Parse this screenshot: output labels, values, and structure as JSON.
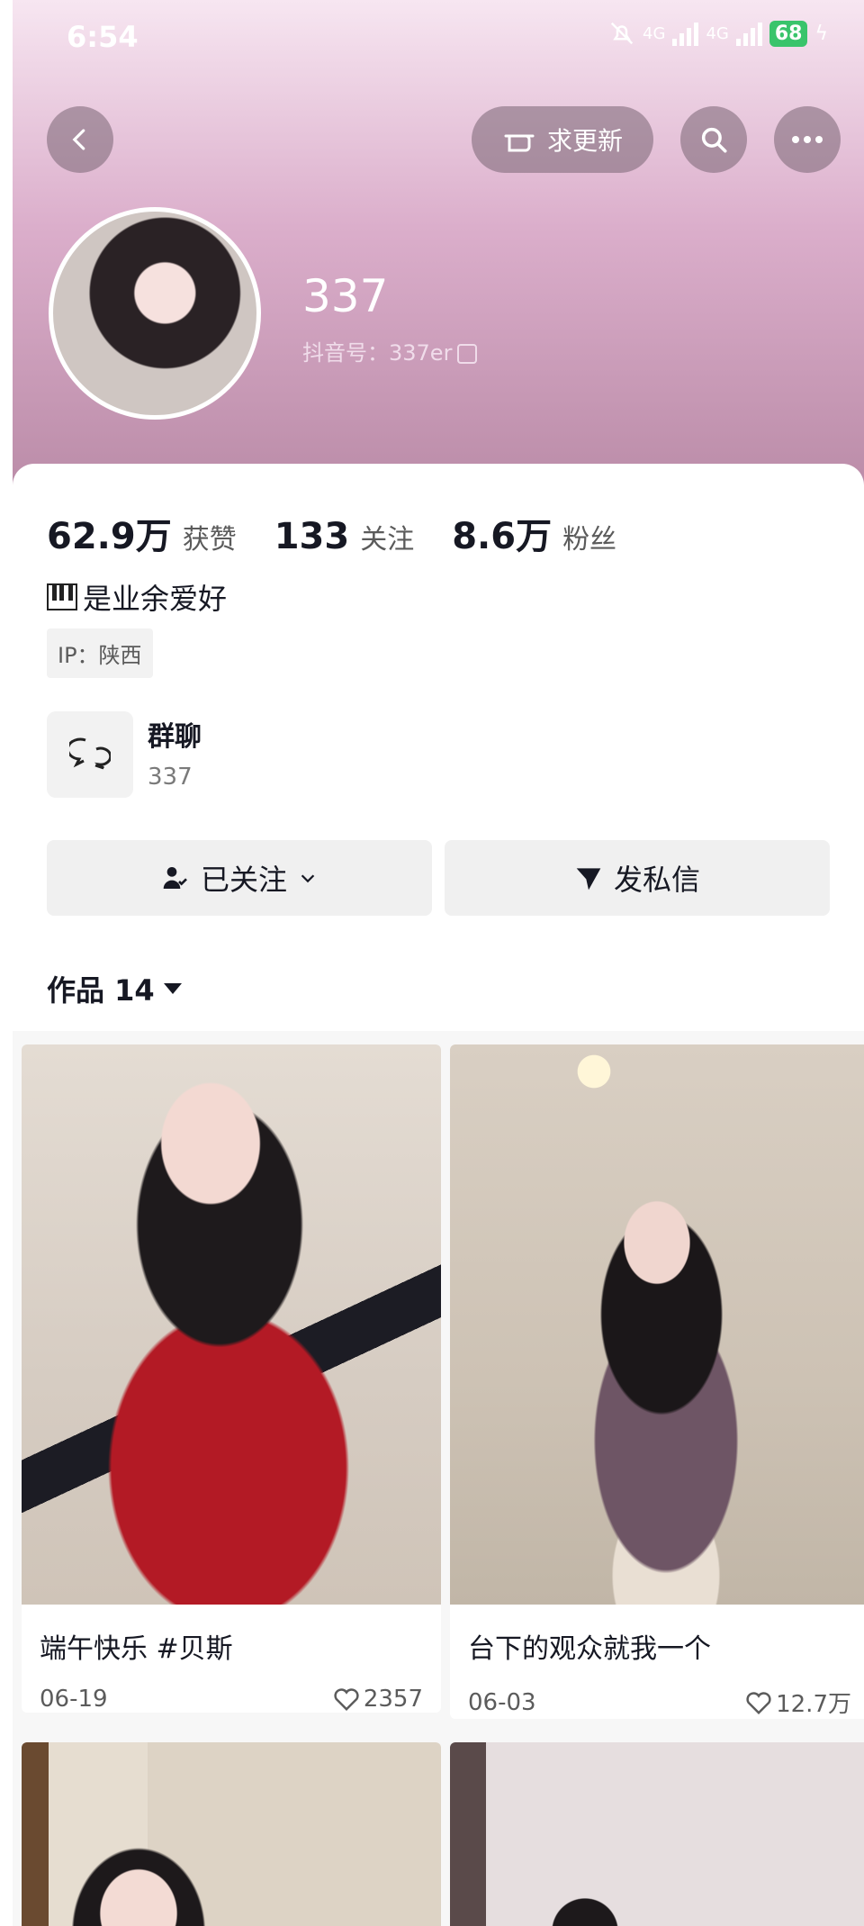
{
  "status_bar": {
    "time": "6:54",
    "network_1": "4G",
    "network_2": "4G",
    "battery": "68"
  },
  "header": {
    "ask_update_label": "求更新"
  },
  "profile": {
    "nickname": "337",
    "douyin_id": "抖音号：337er",
    "stats": [
      {
        "value": "62.9万",
        "label": "获赞"
      },
      {
        "value": "133",
        "label": "关注"
      },
      {
        "value": "8.6万",
        "label": "粉丝"
      }
    ],
    "bio": "是业余爱好",
    "ip": "IP：陕西"
  },
  "group_chat": {
    "title": "群聊",
    "subtitle": "337"
  },
  "actions": {
    "follow_label": "已关注",
    "message_label": "发私信"
  },
  "works": {
    "tab_label": "作品 14"
  },
  "posts": [
    {
      "title": "端午快乐 #贝斯",
      "date": "06-19",
      "likes": "2357"
    },
    {
      "title": "台下的观众就我一个",
      "date": "06-03",
      "likes": "12.7万"
    }
  ],
  "colors": {
    "accent_gradient_top": "#f7e6f1",
    "accent_gradient_bottom": "#b98aa6",
    "battery": "#39c46b"
  }
}
